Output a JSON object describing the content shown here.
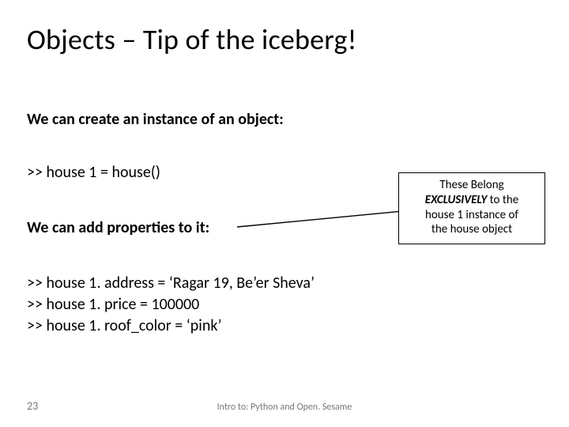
{
  "title": "Objects – Tip of the iceberg!",
  "lines": {
    "create_instance": "We can create an instance of an object:",
    "code1": ">> house 1 = house()",
    "add_props": "We can add properties to it:",
    "code2": ">> house 1. address = ‘Ragar 19, Be’er Sheva’",
    "code3": ">> house 1. price = 100000",
    "code4": ">> house 1. roof_color = ‘pink’"
  },
  "callout": {
    "l1": "These Belong",
    "l2_em": "EXCLUSIVELY",
    "l2_rest": " to the",
    "l3": "house 1 instance of",
    "l4": "the house object"
  },
  "footer": {
    "page": "23",
    "center": "Intro to: Python and Open. Sesame"
  }
}
